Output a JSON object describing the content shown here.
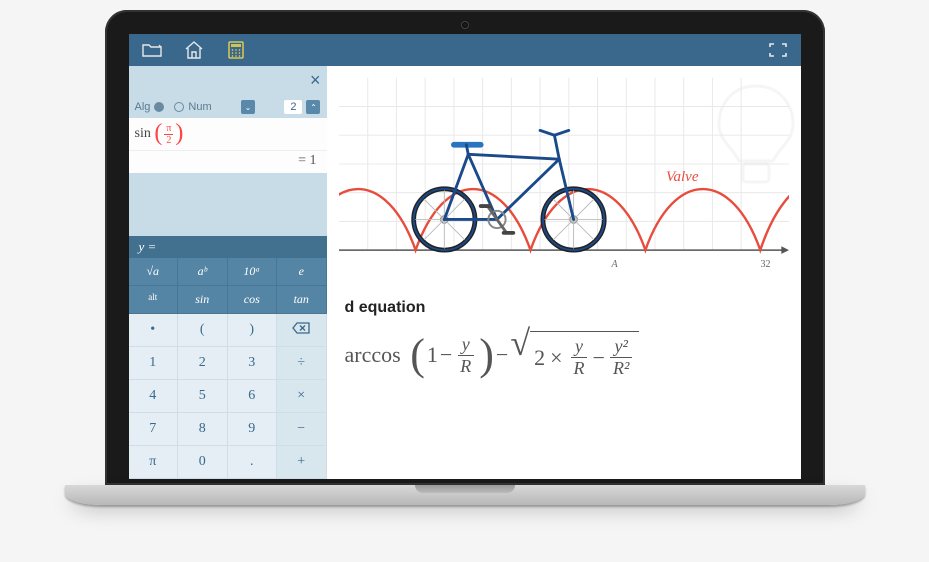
{
  "toolbar": {
    "icons": [
      "folder",
      "home",
      "calculator",
      "fullscreen"
    ]
  },
  "calc": {
    "mode_alg": "Alg",
    "mode_num": "Num",
    "step_value": "2",
    "expression_fn": "sin",
    "expression_num": "π",
    "expression_den": "2",
    "result_prefix": "= ",
    "result": "1",
    "y_eq": "y =",
    "fn_row1": [
      "√a",
      "aᵇ",
      "10ᵃ",
      "e"
    ],
    "fn_row2": [
      "alt",
      "sin",
      "cos",
      "tan"
    ],
    "num_rows": [
      [
        "•",
        "(",
        ")",
        "⌫"
      ],
      [
        "1",
        "2",
        "3",
        "÷"
      ],
      [
        "4",
        "5",
        "6",
        "×"
      ],
      [
        "7",
        "8",
        "9",
        "−"
      ],
      [
        "π",
        "0",
        ".",
        "+"
      ]
    ]
  },
  "workspace": {
    "valve_label": "Valve",
    "axis_label_A": "A",
    "axis_label_32": "32",
    "heading": "d equation",
    "eq_arccos": "arccos",
    "eq_one": "1",
    "eq_minus": " − ",
    "eq_y": "y",
    "eq_R": "R",
    "eq_times": "×",
    "eq_two": "2",
    "eq_y2": "y²",
    "eq_R2": "R²"
  },
  "chart_data": {
    "type": "line",
    "title": "Cycloid valve path",
    "xlabel": "",
    "ylabel": "",
    "xlim": [
      0,
      32
    ],
    "series": [
      {
        "name": "Valve",
        "equation": "R·arccos(1 - y/R) - sqrt(2·y/R - y²/R²)",
        "color": "#e74c3c"
      }
    ],
    "annotations": [
      "A",
      "32",
      "Valve"
    ]
  },
  "colors": {
    "accent": "#3a688c",
    "calc_fn": "#5585a5",
    "curve": "#e74c3c"
  }
}
